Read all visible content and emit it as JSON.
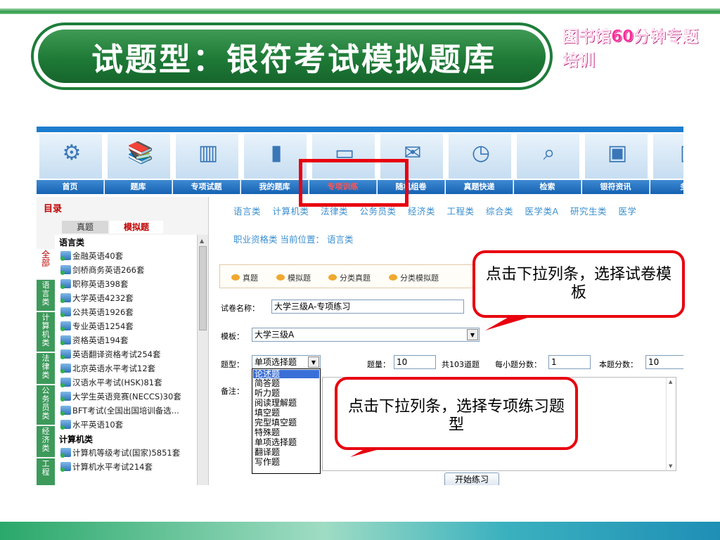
{
  "slide": {
    "title": "试题型：银符考试模拟题库",
    "corner_tag": "图书馆60分钟专题培训"
  },
  "nav": {
    "items": [
      {
        "label": "首页",
        "icon": "home-icon",
        "glyph": "⚙"
      },
      {
        "label": "题库",
        "icon": "books-icon",
        "glyph": "📚"
      },
      {
        "label": "专项试题",
        "icon": "binders-icon",
        "glyph": "▥"
      },
      {
        "label": "我的题库",
        "icon": "notebook-icon",
        "glyph": "▮"
      },
      {
        "label": "专项训练",
        "icon": "paper-icon",
        "glyph": "▭"
      },
      {
        "label": "随机组卷",
        "icon": "scroll-icon",
        "glyph": "✉"
      },
      {
        "label": "真题快递",
        "icon": "stopwatch-icon",
        "glyph": "◷"
      },
      {
        "label": "检索",
        "icon": "magnifier-icon",
        "glyph": "⌕"
      },
      {
        "label": "银符资讯",
        "icon": "monitor-icon",
        "glyph": "▣"
      },
      {
        "label": "多",
        "icon": "more-icon",
        "glyph": "▯"
      }
    ]
  },
  "left": {
    "heading": "目录",
    "tab_zhenti": "真题",
    "tab_moni": "模拟题",
    "side_categories": [
      "全部",
      "语言类",
      "计算机类",
      "法律类",
      "公务员类",
      "经济类",
      "工程"
    ],
    "groups": [
      {
        "name": "语言类",
        "items": [
          "金融英语40套",
          "剑桥商务英语266套",
          "职称英语398套",
          "大学英语4232套",
          "公共英语1926套",
          "专业英语1254套",
          "资格英语194套",
          "英语翻译资格考试254套",
          "北京英语水平考试12套",
          "汉语水平考试(HSK)81套",
          "大学生英语竞赛(NECCS)30套",
          "BFT考试(全国出国培训备选...",
          "水平英语10套"
        ]
      },
      {
        "name": "计算机类",
        "items": [
          "计算机等级考试(国家)5851套",
          "计算机水平考试214套"
        ]
      }
    ]
  },
  "right": {
    "categories": [
      "语言类",
      "计算机类",
      "法律类",
      "公务员类",
      "经济类",
      "工程类",
      "综合类",
      "医学类A",
      "研究生类",
      "医学"
    ],
    "location": "职业资格类 当前位置： 语言类",
    "filters": [
      "真题",
      "模拟题",
      "分类真题",
      "分类模拟题"
    ],
    "paper_name_label": "试卷名称：",
    "paper_name_value": "大学三级A-专项练习",
    "template_label": "模板：",
    "template_value": "大学三级A",
    "qtype_label": "题型：",
    "qtype_value": "单项选择题",
    "qtype_options": [
      "论述题",
      "简答题",
      "听力题",
      "阅读理解题",
      "填空题",
      "完型填空题",
      "特殊题",
      "单项选择题",
      "翻译题",
      "写作题"
    ],
    "qty_label": "题量：",
    "qty_value": "10",
    "total_text": "共103道题",
    "per_score_label": "每小题分数：",
    "per_score_value": "1",
    "total_score_label": "本题分数：",
    "total_score_value": "10",
    "notes_label": "备注：",
    "start_button": "开始练习"
  },
  "callouts": {
    "template_hint": "点击下拉列条，选择试卷模板",
    "qtype_hint": "点击下拉列条，选择专项练习题型"
  },
  "colors": {
    "title_green": "#1e7a36",
    "nav_blue": "#1562b3",
    "highlight_red": "#e8000e",
    "tag_pink": "#ff2a9a"
  }
}
